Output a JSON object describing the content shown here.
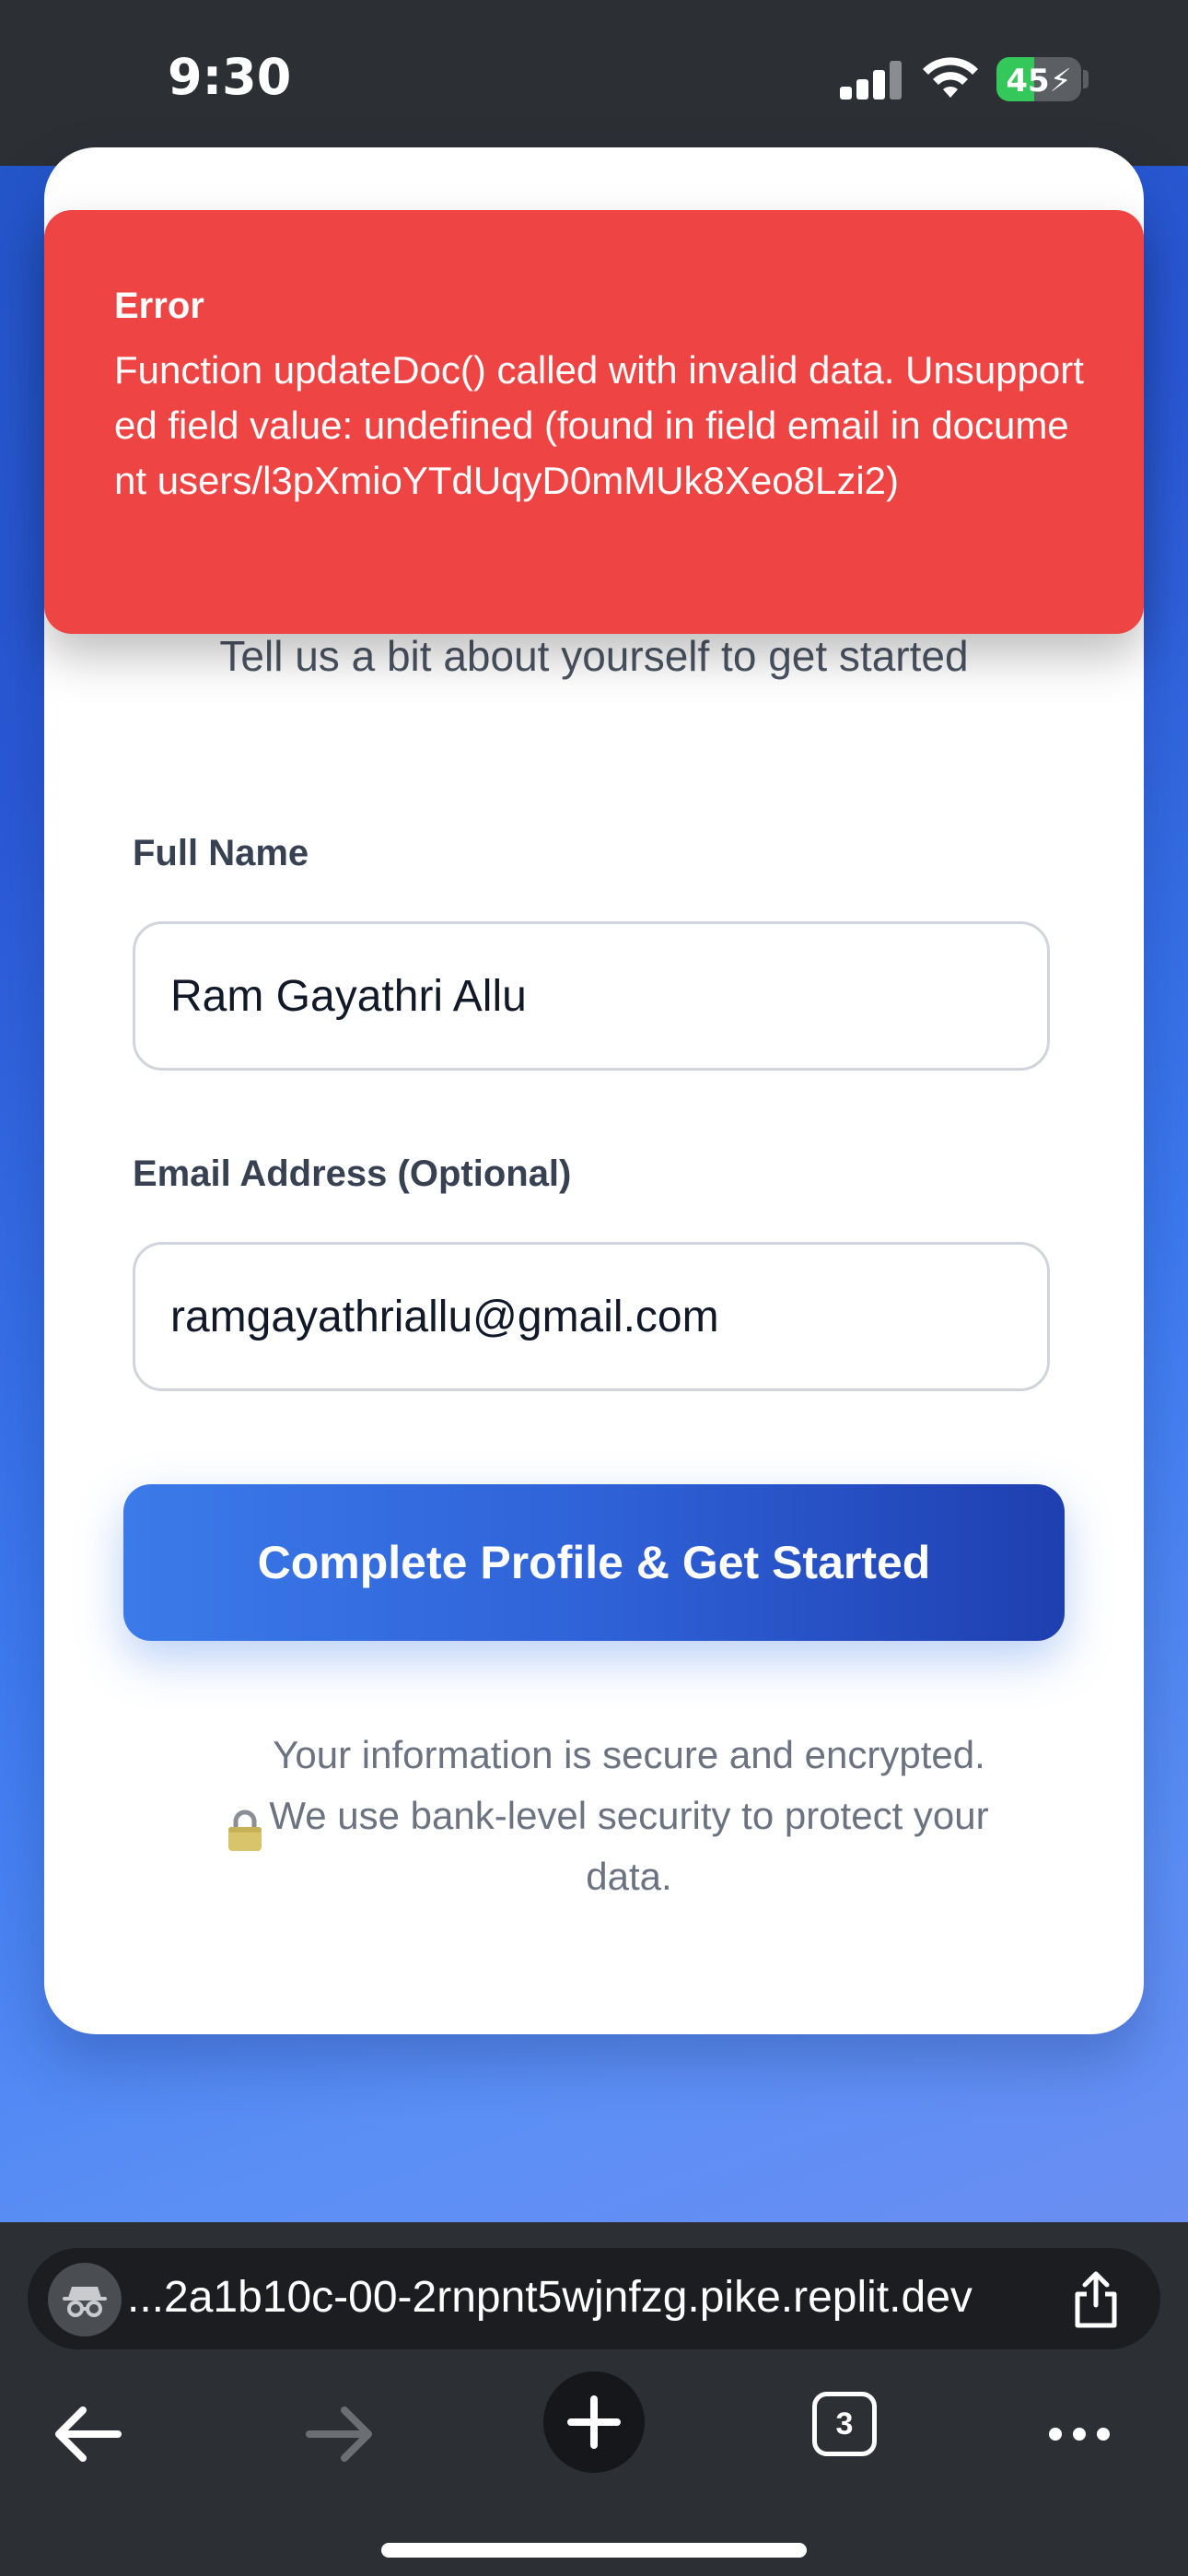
{
  "status_bar": {
    "time": "9:30",
    "battery_level": "45",
    "icons": [
      "cellular-signal-icon",
      "wifi-icon",
      "battery-charging-icon"
    ]
  },
  "error": {
    "title": "Error",
    "message": "Function updateDoc() called with invalid data. Unsupported field value: undefined (found in field email in document users/l3pXmioYTdUqyD0mMUk8Xeo8Lzi2)",
    "color": "#ef4444"
  },
  "form": {
    "subtitle": "Tell us a bit about yourself to get started",
    "full_name": {
      "label": "Full Name",
      "value": "Ram Gayathri Allu"
    },
    "email": {
      "label": "Email Address (Optional)",
      "value": "ramgayathriallu@gmail.com"
    },
    "submit_label": "Complete Profile & Get Started",
    "security_note": "Your information is secure and encrypted. We use bank-level security to protect your data.",
    "accent_color": "#3b7ae9"
  },
  "browser": {
    "url": "...2a1b10c-00-2rnpnt5wjnfzg.pike.replit.dev",
    "tab_count": "3",
    "icons": [
      "incognito-icon",
      "share-icon",
      "back-arrow-icon",
      "forward-arrow-icon",
      "new-tab-plus-icon",
      "tabs-icon",
      "more-icon"
    ]
  }
}
